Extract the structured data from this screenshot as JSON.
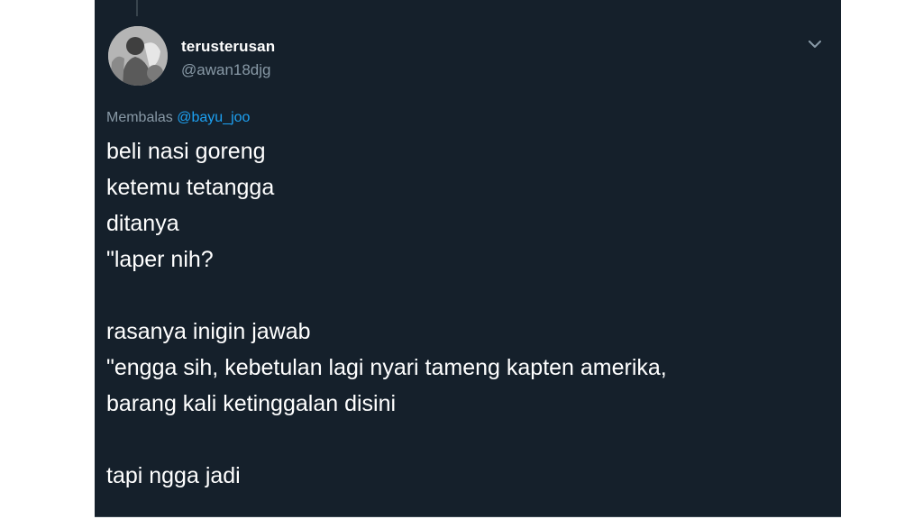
{
  "tweet": {
    "user": {
      "display_name": "terusterusan",
      "handle": "@awan18djg",
      "avatar_icon": "user-avatar-photo"
    },
    "reply": {
      "prefix": "Membalas",
      "mention": "@bayu_joo"
    },
    "menu_icon": "chevron-down-icon",
    "text_lines": [
      "beli nasi goreng",
      "ketemu tetangga",
      "ditanya",
      "\"laper nih?",
      "",
      "rasanya inigin jawab",
      "\"engga sih, kebetulan lagi nyari tameng kapten amerika,",
      "barang kali ketinggalan disini",
      "",
      "tapi ngga jadi"
    ]
  },
  "colors": {
    "background": "#15202b",
    "primary_text": "#ffffff",
    "secondary_text": "#8899a6",
    "link": "#1da1f2"
  }
}
